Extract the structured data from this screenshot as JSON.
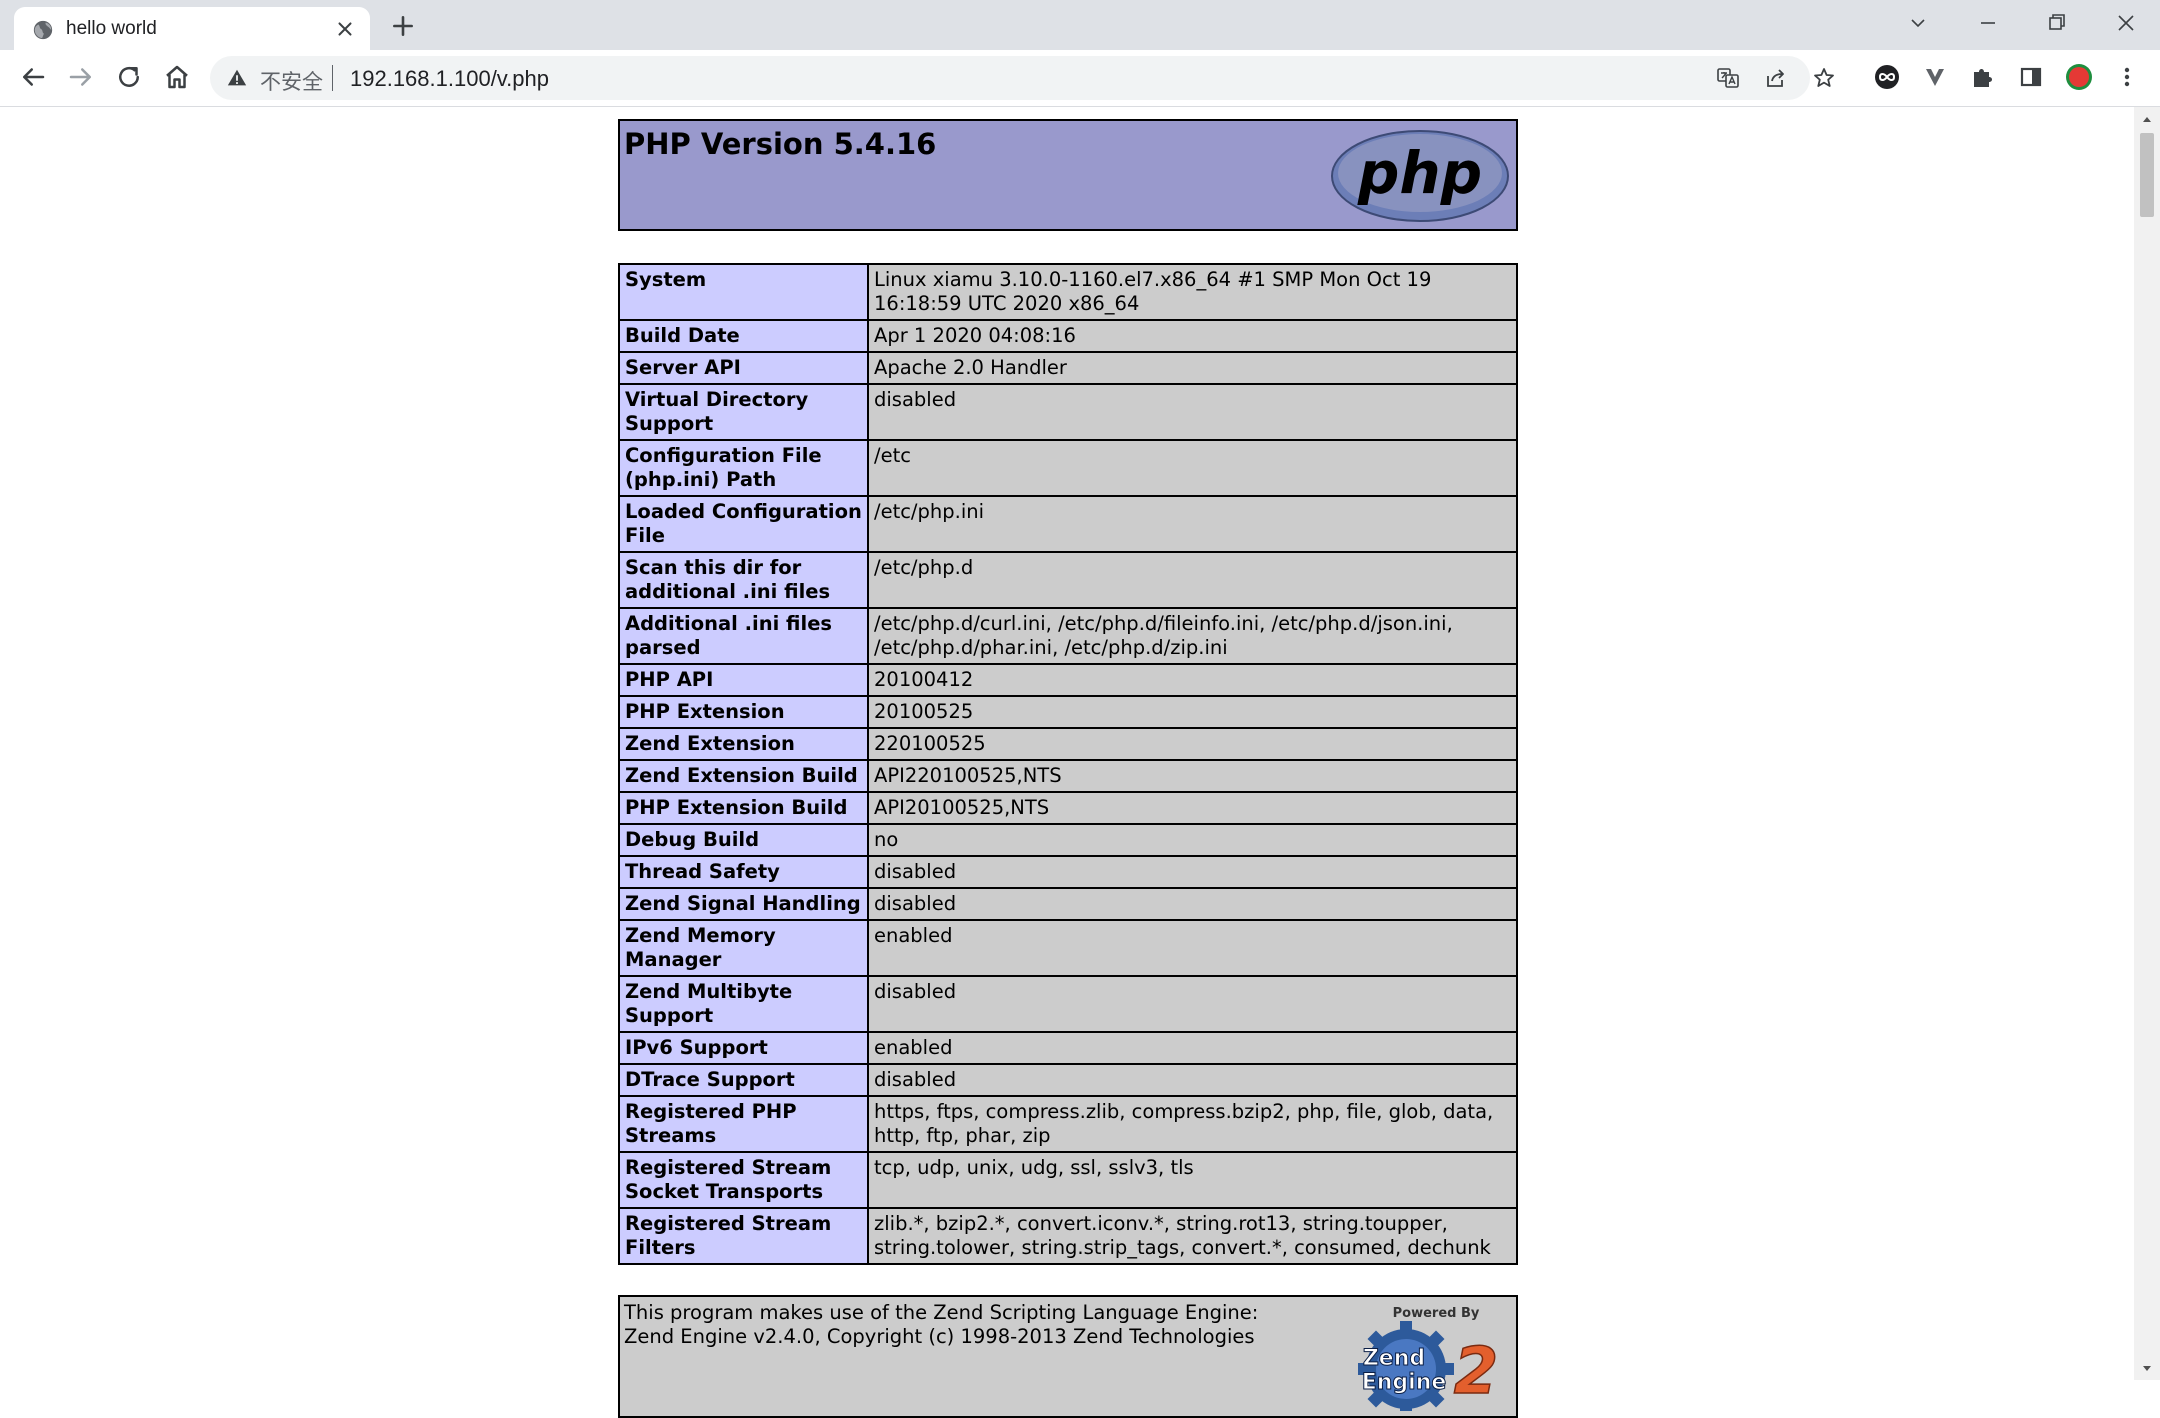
{
  "browser": {
    "tab_title": "hello world",
    "security_label": "不安全",
    "url": "192.168.1.100/v.php"
  },
  "page": {
    "title": "PHP Version 5.4.16",
    "logo_text": "php",
    "rows": [
      {
        "key": "System",
        "value": "Linux xiamu 3.10.0-1160.el7.x86_64 #1 SMP Mon Oct 19 16:18:59 UTC 2020 x86_64"
      },
      {
        "key": "Build Date",
        "value": "Apr 1 2020 04:08:16"
      },
      {
        "key": "Server API",
        "value": "Apache 2.0 Handler"
      },
      {
        "key": "Virtual Directory Support",
        "value": "disabled"
      },
      {
        "key": "Configuration File (php.ini) Path",
        "value": "/etc"
      },
      {
        "key": "Loaded Configuration File",
        "value": "/etc/php.ini"
      },
      {
        "key": "Scan this dir for additional .ini files",
        "value": "/etc/php.d"
      },
      {
        "key": "Additional .ini files parsed",
        "value": "/etc/php.d/curl.ini, /etc/php.d/fileinfo.ini, /etc/php.d/json.ini, /etc/php.d/phar.ini, /etc/php.d/zip.ini"
      },
      {
        "key": "PHP API",
        "value": "20100412"
      },
      {
        "key": "PHP Extension",
        "value": "20100525"
      },
      {
        "key": "Zend Extension",
        "value": "220100525"
      },
      {
        "key": "Zend Extension Build",
        "value": "API220100525,NTS"
      },
      {
        "key": "PHP Extension Build",
        "value": "API20100525,NTS"
      },
      {
        "key": "Debug Build",
        "value": "no"
      },
      {
        "key": "Thread Safety",
        "value": "disabled"
      },
      {
        "key": "Zend Signal Handling",
        "value": "disabled"
      },
      {
        "key": "Zend Memory Manager",
        "value": "enabled"
      },
      {
        "key": "Zend Multibyte Support",
        "value": "disabled"
      },
      {
        "key": "IPv6 Support",
        "value": "enabled"
      },
      {
        "key": "DTrace Support",
        "value": "disabled"
      },
      {
        "key": "Registered PHP Streams",
        "value": "https, ftps, compress.zlib, compress.bzip2, php, file, glob, data, http, ftp, phar, zip"
      },
      {
        "key": "Registered Stream Socket Transports",
        "value": "tcp, udp, unix, udg, ssl, sslv3, tls"
      },
      {
        "key": "Registered Stream Filters",
        "value": "zlib.*, bzip2.*, convert.iconv.*, string.rot13, string.toupper, string.tolower, string.strip_tags, convert.*, consumed, dechunk"
      }
    ],
    "footer": {
      "line1": "This program makes use of the Zend Scripting Language Engine:",
      "line2": "Zend Engine v2.4.0, Copyright (c) 1998-2013 Zend Technologies",
      "powered_by": "Powered By",
      "zend_logo_line1": "Zend",
      "zend_logo_line2": "Engine",
      "zend_logo_num": "2"
    }
  },
  "colors": {
    "header_bg": "#9999cc",
    "key_bg": "#ccccff",
    "value_bg": "#cccccc"
  },
  "icons": [
    "globe-icon",
    "close-icon",
    "plus-icon",
    "chevron-down-icon",
    "minimize-icon",
    "restore-icon",
    "window-close-icon",
    "back-arrow-icon",
    "forward-arrow-icon",
    "reload-icon",
    "home-icon",
    "warning-icon",
    "translate-icon",
    "share-icon",
    "star-icon",
    "extension-infinity-icon",
    "extension-v-icon",
    "puzzle-icon",
    "side-panel-icon",
    "profile-avatar-icon",
    "kebab-menu-icon"
  ]
}
